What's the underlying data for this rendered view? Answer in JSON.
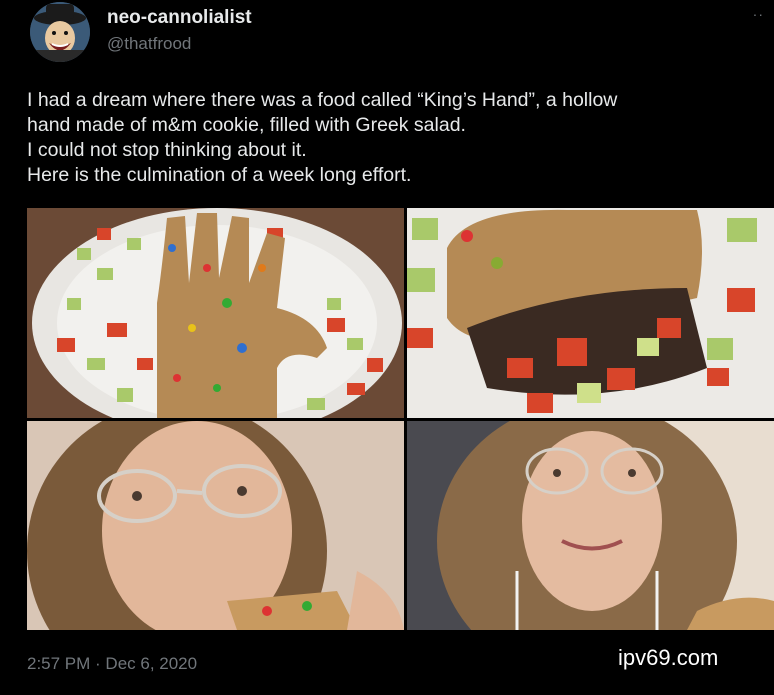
{
  "author": {
    "display_name": "neo-cannolialist",
    "handle": "@thatfrood",
    "avatar_icon": "cartoon-character-avatar"
  },
  "more_label": "··",
  "tweet": {
    "lines": [
      "I had a dream where there was a food called “King’s Hand”, a hollow",
      "hand made of m&m cookie, filled with Greek salad.",
      "I could not stop thinking about it.",
      "Here is the culmination of a week long effort."
    ]
  },
  "timestamp": "2:57 PM · Dec 6, 2020",
  "watermark": "ipv69.com",
  "colors": {
    "background": "#000000",
    "text": "#e7e9ea",
    "secondary": "#71767b"
  }
}
